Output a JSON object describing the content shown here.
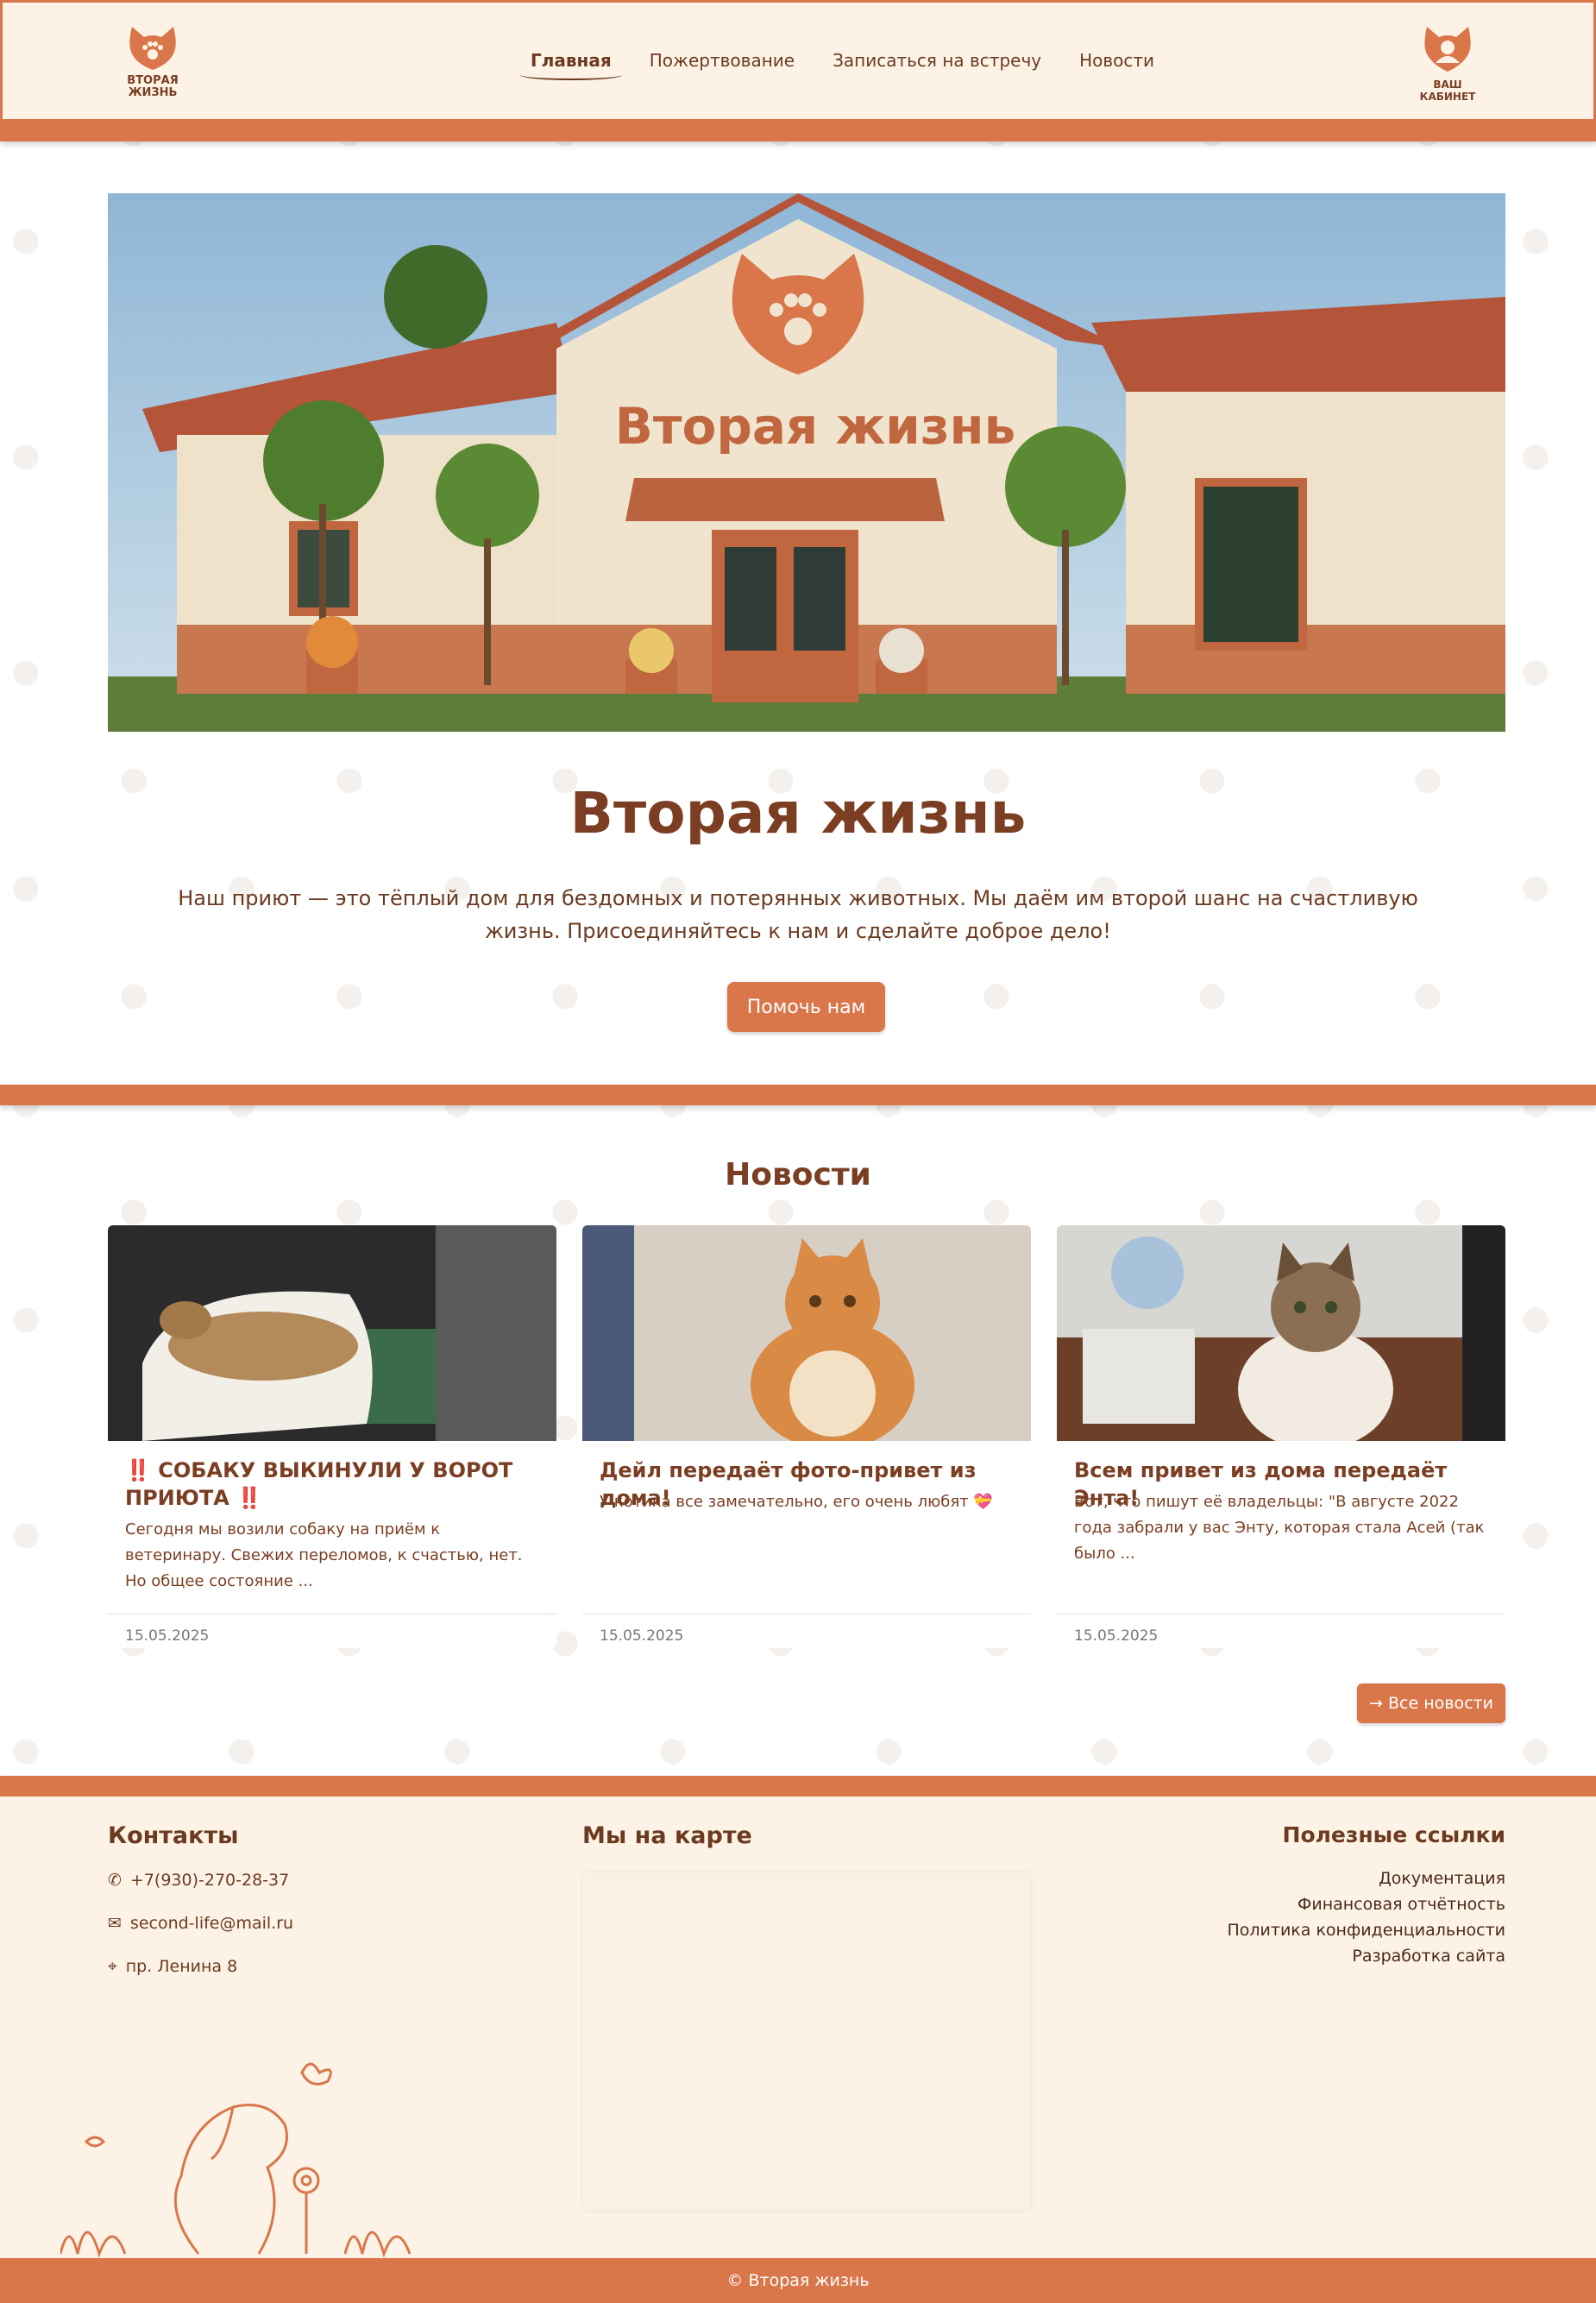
{
  "header": {
    "logo_text": "Вторая жизнь",
    "nav": [
      {
        "label": "Главная",
        "active": true
      },
      {
        "label": "Пожертвование",
        "active": false
      },
      {
        "label": "Записаться на встречу",
        "active": false
      },
      {
        "label": "Новости",
        "active": false
      }
    ],
    "cabinet_label": "Ваш кабинет"
  },
  "hero": {
    "image_sign": "Вторая жизнь",
    "title": "Вторая жизнь",
    "text": "Наш приют — это тёплый дом для бездомных и потерянных животных. Мы даём им второй шанс на счастливую жизнь. Присоединяйтесь к нам и сделайте доброе дело!",
    "button": "Помочь нам"
  },
  "news": {
    "title": "Новости",
    "cards": [
      {
        "title": "‼️ СОБАКУ ВЫКИНУЛИ У ВОРОТ ПРИЮТА ‼️",
        "text": "Сегодня мы возили собаку на приём к ветеринару. Свежих переломов, к счастью, нет. Но общее состояние ...",
        "date": "15.05.2025"
      },
      {
        "title": "Дейл передаёт фото-привет из дома!",
        "text": "У котика все замечательно, его очень любят 💝",
        "date": "15.05.2025"
      },
      {
        "title": "Всем привет из дома передаёт Энта!",
        "text": "Вот, что пишут её владельцы: \"В августе 2022 года забрали у вас Энту, которая стала Асей (так было ...",
        "date": "15.05.2025"
      }
    ],
    "all_button": "Все новости"
  },
  "footer": {
    "contacts_title": "Контакты",
    "phone": "+7(930)-270-28-37",
    "email": "second-life@mail.ru",
    "address": "пр. Ленина 8",
    "map_title": "Мы на карте",
    "links_title": "Полезные ссылки",
    "links": [
      "Документация",
      "Финансовая отчётность",
      "Политика конфиденциальности",
      "Разработка сайта"
    ],
    "copyright": "© Вторая жизнь"
  },
  "colors": {
    "accent": "#d9764a",
    "text": "#6b3a20",
    "footer_bg": "#fcf3e6"
  }
}
